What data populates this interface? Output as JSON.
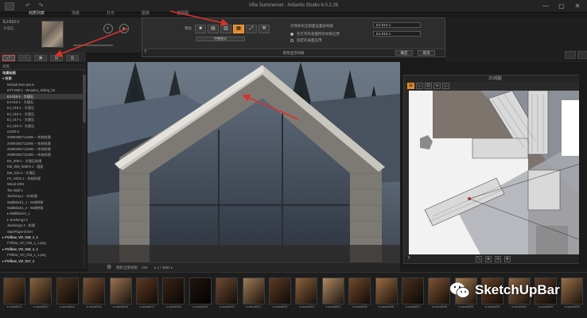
{
  "window": {
    "title": "Villa Summerset - Artlantis Studio 6.0.2.26",
    "minimize": "—",
    "maximize": "▢",
    "close": "✕"
  },
  "menu": {
    "items": [
      "材质列表",
      "场景",
      "灯光",
      "图像",
      "透视图"
    ]
  },
  "material_header": {
    "name": "EJ-010-1",
    "sub": "大理石"
  },
  "left_panel": {
    "search_label": "场景",
    "tree": [
      {
        "label": "场景贴图",
        "type": "group"
      },
      {
        "label": "▾ 材质",
        "type": "group"
      },
      {
        "label": "Default-bois-pinus",
        "type": "item"
      },
      {
        "label": "EFT-090-1 - Wooden_Siding_03",
        "type": "item"
      },
      {
        "label": "EJ-010-1 - 大理石",
        "type": "selected"
      },
      {
        "label": "EJ-010-1 - 大理石",
        "type": "item"
      },
      {
        "label": "EJ_015-1 - 大理石",
        "type": "item"
      },
      {
        "label": "EJ_015-1 - 大理石",
        "type": "item"
      },
      {
        "label": "EJ_017-1 - 大理石",
        "type": "item"
      },
      {
        "label": "EJ_019-2 - 大理石",
        "type": "item"
      },
      {
        "label": "eJ029-2",
        "type": "item"
      },
      {
        "label": "2009030271130ts ~ 木材纹理",
        "type": "item"
      },
      {
        "label": "2009030271130ts ~ 木材纹理",
        "type": "item"
      },
      {
        "label": "2009030271130ts ~ 木材纹理",
        "type": "item"
      },
      {
        "label": "2009030271130ts ~ 木材纹理",
        "type": "item"
      },
      {
        "label": "EK_009-1 - 大理石纹理",
        "type": "item"
      },
      {
        "label": "EM_009_Wall-5-1 - 墙面",
        "type": "item"
      },
      {
        "label": "EM_010-1 - 大理石",
        "type": "item"
      },
      {
        "label": "FS_H015-1 - 木材纹理",
        "type": "item"
      },
      {
        "label": "Wood-1001",
        "type": "item"
      },
      {
        "label": "Tile-Wall-1",
        "type": "item"
      },
      {
        "label": "Jiesheng-1 - Jie纹理",
        "type": "item"
      },
      {
        "label": "WallBlock1_1 - Wall拼接",
        "type": "item"
      },
      {
        "label": "WallBlock1_2 - Wall拼接",
        "type": "item"
      },
      {
        "label": "▸ WallBlock2_1",
        "type": "item"
      },
      {
        "label": "▸ Jiesheng1-1",
        "type": "item"
      },
      {
        "label": "Jiesheng1-2 - 纹理",
        "type": "item"
      },
      {
        "label": "StartPlayer2VDH",
        "type": "item"
      },
      {
        "label": "▸ FVillow_VO_018_1_1",
        "type": "group"
      },
      {
        "label": "FVillow_VO_018_1_1.png",
        "type": "item"
      },
      {
        "label": "▸ FVillow_VO_018_1_1",
        "type": "group"
      },
      {
        "label": "FVillow_VO_018_1_1.png",
        "type": "item"
      },
      {
        "label": "▸ FVillow_VO_017_1",
        "type": "group"
      }
    ]
  },
  "popup": {
    "tab_label": "预设",
    "tool_icons": [
      "■",
      "▤",
      "▥",
      "▦",
      "⤢",
      "⚒"
    ],
    "active_index": 3,
    "sub_button": "完整模式",
    "right_label_top": "在物体的全部面设置此材质",
    "right_field_value": "EJ-010-1",
    "right_field2": "EJ-010-1",
    "radio1": "在打开的表面所有材质应用",
    "radio2": "指定的表面应用",
    "footer_text": "更改显示材质",
    "ok": "确定",
    "cancel": "取消",
    "corner": "?"
  },
  "viewport": {
    "zoom_label": "相机全景视角",
    "zoom_value": "150",
    "status": "▸ 1 / 3682 ▸"
  },
  "map_panel": {
    "title": "2D视图",
    "tools": [
      "⊞",
      "⌂",
      "⊡",
      "⌖",
      "⌂"
    ],
    "bottom_left": "Y",
    "bottom_tools": [
      "⤡",
      "⊕",
      "⊖",
      "⚙"
    ]
  },
  "swatches": [
    {
      "label": "e-wood012",
      "color": "#6b4a2f"
    },
    {
      "label": "e-wood013",
      "color": "#8a6440"
    },
    {
      "label": "e-wood014",
      "color": "#4d3322"
    },
    {
      "label": "e-wood015",
      "color": "#7a5237"
    },
    {
      "label": "e-wood016",
      "color": "#9b7452"
    },
    {
      "label": "e-wood017",
      "color": "#5e3a24"
    },
    {
      "label": "e-wood018",
      "color": "#3a2418"
    },
    {
      "label": "e-wood019",
      "color": "#1e140e"
    },
    {
      "label": "e-wood020",
      "color": "#6e4b33"
    },
    {
      "label": "e-wood021",
      "color": "#a07a55"
    },
    {
      "label": "e-wood022",
      "color": "#5a3a26"
    },
    {
      "label": "e-wood023",
      "color": "#8c623f"
    },
    {
      "label": "e-wood024",
      "color": "#b08a62"
    },
    {
      "label": "e-wood025",
      "color": "#70482c"
    },
    {
      "label": "e-wood026",
      "color": "#9a6c44"
    },
    {
      "label": "e-wood027",
      "color": "#4a3020"
    },
    {
      "label": "e-wood028",
      "color": "#7e5434"
    },
    {
      "label": "e-wood029",
      "color": "#a37a52"
    },
    {
      "label": "e-wood030",
      "color": "#6a442a"
    },
    {
      "label": "e-wood031",
      "color": "#8e6644"
    },
    {
      "label": "e-wood032",
      "color": "#5c3c28"
    },
    {
      "label": "e-wood033",
      "color": "#9c7048"
    }
  ],
  "watermark": {
    "text": "SketchUpBar"
  },
  "colors": {
    "accent": "#e08a2a",
    "arrow": "#d9312b"
  }
}
